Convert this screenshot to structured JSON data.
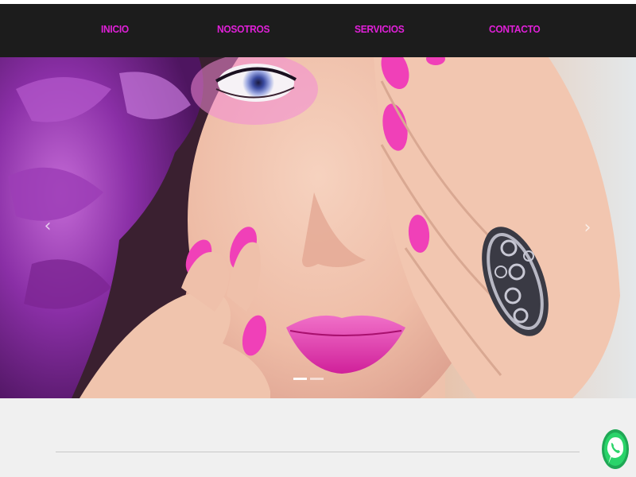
{
  "nav": {
    "items": [
      {
        "label": "INICIO"
      },
      {
        "label": "NOSOTROS"
      },
      {
        "label": "SERVICIOS"
      },
      {
        "label": "CONTACTO"
      }
    ]
  },
  "hero": {
    "image": "beauty-model-pink-nails-purple-flower",
    "slides_total": 2,
    "active_slide": 1
  },
  "colors": {
    "nav_bg": "#1c1c1c",
    "nav_link": "#e020d8",
    "content_bg": "#f0f0f0",
    "whatsapp_green": "#25d366"
  },
  "floating": {
    "icon": "whatsapp-icon"
  }
}
